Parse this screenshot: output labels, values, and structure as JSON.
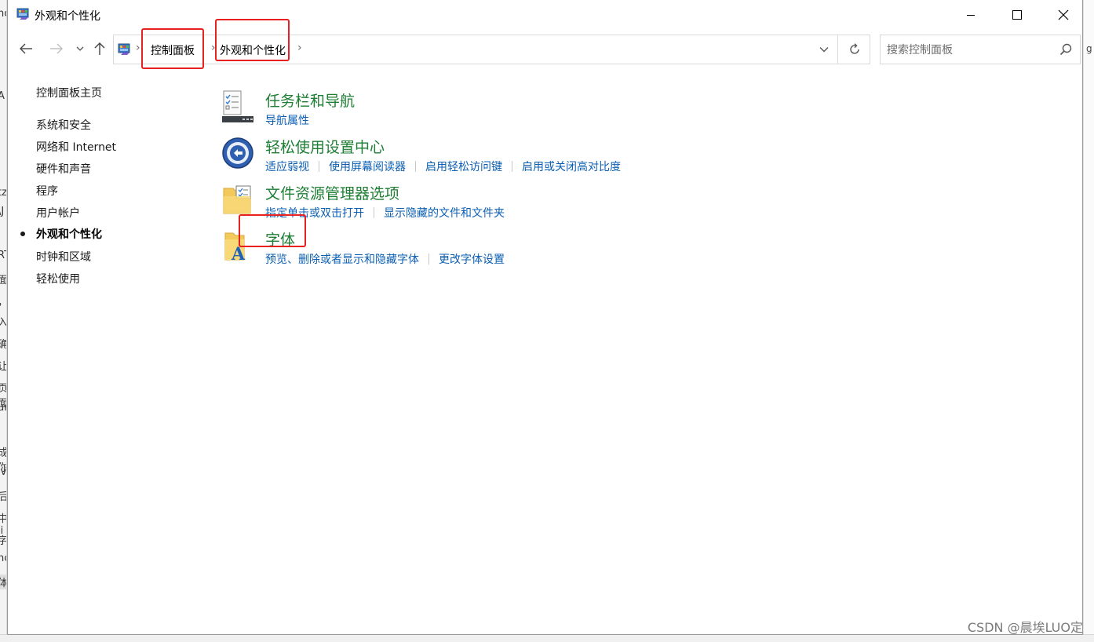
{
  "window": {
    "title": "外观和个性化"
  },
  "background": {
    "left_fragments": [
      "nc",
      "A",
      "tz",
      "\\J",
      "RT",
      "面",
      "，",
      "入",
      "确",
      "让",
      "页面",
      "un",
      "成你",
      "iv",
      "后",
      "中ji",
      "字",
      "nc",
      "体"
    ],
    "right_fragment": "g"
  },
  "navigation": {
    "back_icon": "arrow-left-icon",
    "forward_icon": "arrow-right-icon",
    "recent_icon": "chevron-down-icon",
    "up_icon": "arrow-up-icon"
  },
  "address": {
    "breadcrumbs": [
      "控制面板",
      "外观和个性化"
    ],
    "separator": "›"
  },
  "search": {
    "placeholder": "搜索控制面板"
  },
  "sidebar": {
    "items": [
      {
        "label": "控制面板主页"
      },
      {
        "label": "系统和安全"
      },
      {
        "label": "网络和 Internet"
      },
      {
        "label": "硬件和声音"
      },
      {
        "label": "程序"
      },
      {
        "label": "用户帐户"
      },
      {
        "label": "外观和个性化"
      },
      {
        "label": "时钟和区域"
      },
      {
        "label": "轻松使用"
      }
    ],
    "active_index": 6
  },
  "categories": [
    {
      "title": "任务栏和导航",
      "icon": "taskbar-icon",
      "links": [
        "导航属性"
      ]
    },
    {
      "title": "轻松使用设置中心",
      "icon": "ease-of-access-icon",
      "links": [
        "适应弱视",
        "使用屏幕阅读器",
        "启用轻松访问键",
        "启用或关闭高对比度"
      ]
    },
    {
      "title": "文件资源管理器选项",
      "icon": "folder-options-icon",
      "links": [
        "指定单击或双击打开",
        "显示隐藏的文件和文件夹"
      ]
    },
    {
      "title": "字体",
      "icon": "fonts-folder-icon",
      "links": [
        "预览、删除或者显示和隐藏字体",
        "更改字体设置"
      ]
    }
  ],
  "watermark": "CSDN @晨埃LUO定",
  "colors": {
    "category_title": "#1e7e34",
    "link": "#0b5fb3",
    "highlight_box": "#e8201f"
  }
}
